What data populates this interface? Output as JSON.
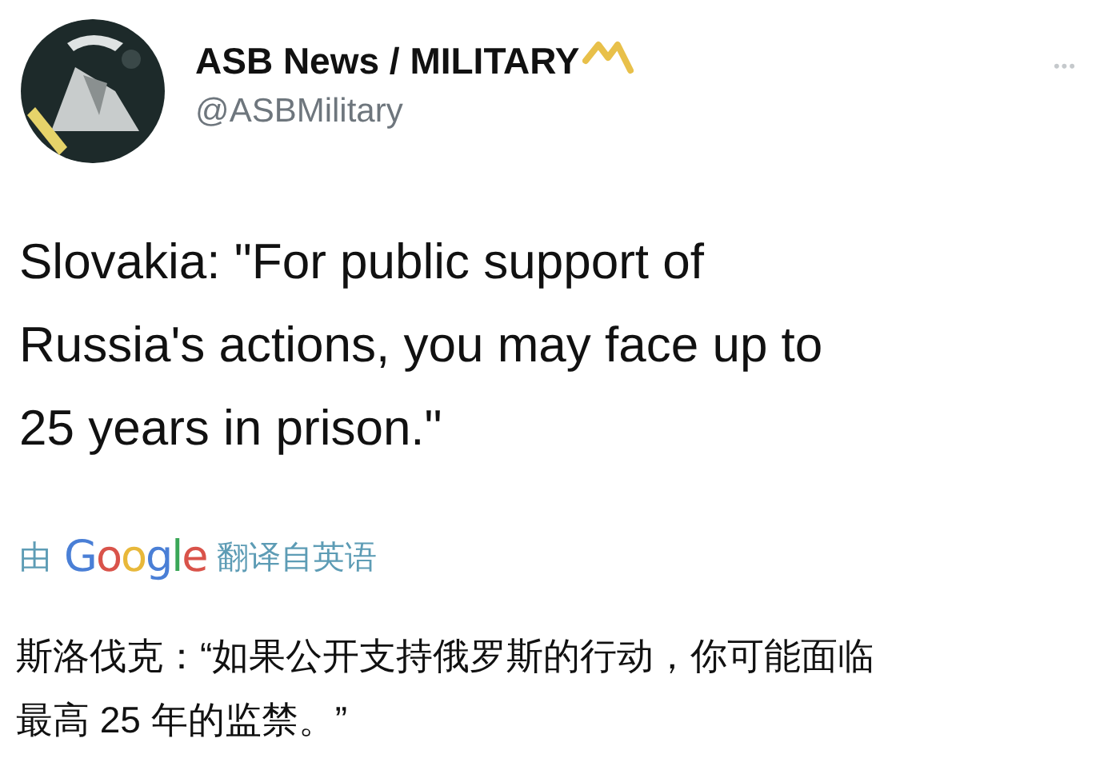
{
  "author": {
    "name": "ASB News / MILITARY",
    "handle": "@ASBMilitary"
  },
  "more_menu": "•••",
  "tweet_text_lines": [
    "Slovakia: \"For public support of",
    "Russia's actions, you may face up to",
    "25 years in prison.\""
  ],
  "translation_credit": {
    "prefix": "由",
    "brand": "Google",
    "suffix": "翻译自英语"
  },
  "translated_text_lines": [
    "斯洛伐克：“如果公开支持俄罗斯的行动，你可能面临",
    "最高 25 年的监禁。”"
  ]
}
